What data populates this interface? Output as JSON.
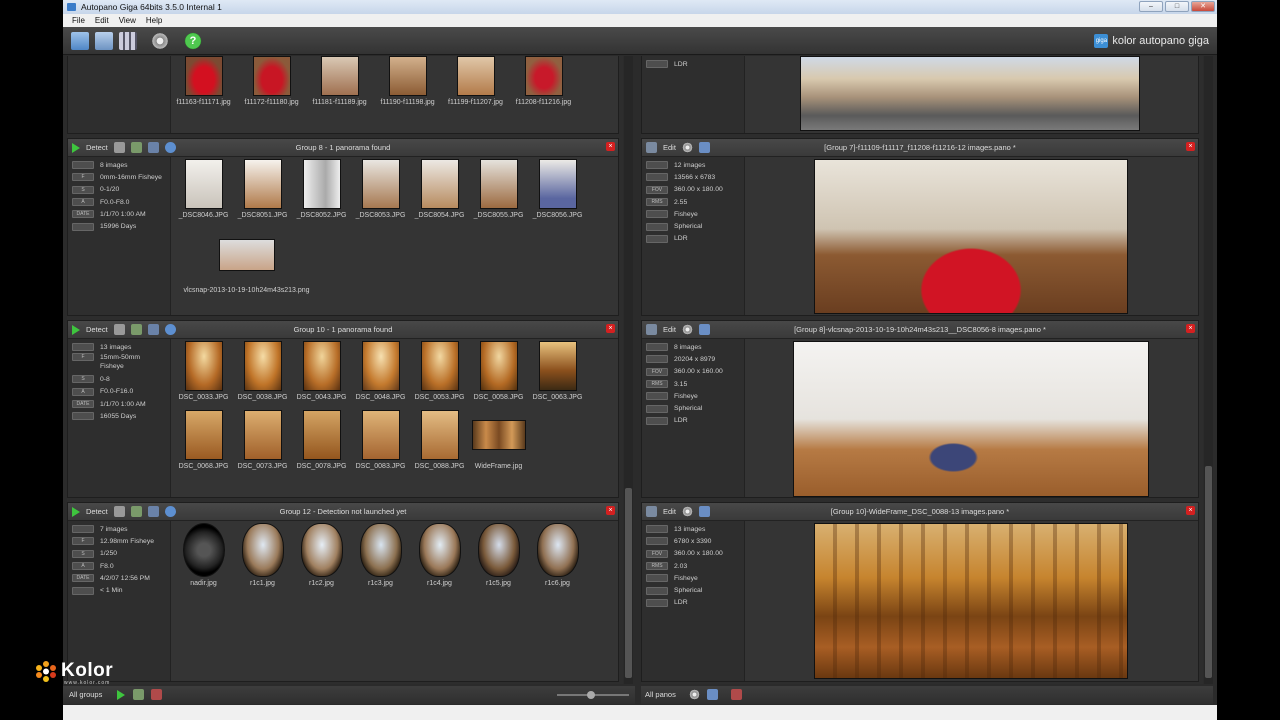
{
  "window": {
    "title": "Autopano Giga 64bits 3.5.0 Internal 1"
  },
  "menu": [
    "File",
    "Edit",
    "View",
    "Help"
  ],
  "brand": {
    "text": "kolor autopano giga",
    "logo": "giga"
  },
  "watermark": {
    "name": "Kolor",
    "site": "www.kolor.com"
  },
  "groups_panel": {
    "top_thumbs": [
      "f11163-f11171.jpg",
      "f11172-f11180.jpg",
      "f11181-f11189.jpg",
      "f11190-f11198.jpg",
      "f11199-f11207.jpg",
      "f11208-f11216.jpg"
    ],
    "detect_label": "Detect",
    "groups": [
      {
        "title": "Group 8 - 1 panorama found",
        "info": [
          "8 images",
          "0mm-16mm Fisheye",
          "0-1/20",
          "F0.0-F8.0",
          "1/1/70 1:00 AM",
          "15996 Days"
        ],
        "info_keys": [
          "",
          "F",
          "S",
          "A",
          "DATE",
          ""
        ],
        "thumbs": [
          "_DSC8046.JPG",
          "_DSC8051.JPG",
          "_DSC8052.JPG",
          "_DSC8053.JPG",
          "_DSC8054.JPG",
          "_DSC8055.JPG",
          "_DSC8056.JPG"
        ],
        "extra": "vlcsnap-2013-10-19-10h24m43s213.png"
      },
      {
        "title": "Group 10 - 1 panorama found",
        "info": [
          "13 images",
          "15mm-50mm Fisheye",
          "0-8",
          "F0.0-F16.0",
          "1/1/70 1:00 AM",
          "16055 Days"
        ],
        "info_keys": [
          "",
          "F",
          "S",
          "A",
          "DATE",
          ""
        ],
        "thumbs": [
          "DSC_0033.JPG",
          "DSC_0038.JPG",
          "DSC_0043.JPG",
          "DSC_0048.JPG",
          "DSC_0053.JPG",
          "DSC_0058.JPG",
          "DSC_0063.JPG",
          "DSC_0068.JPG",
          "DSC_0073.JPG",
          "DSC_0078.JPG",
          "DSC_0083.JPG",
          "DSC_0088.JPG",
          "WideFrame.jpg"
        ]
      },
      {
        "title": "Group 12 - Detection not launched yet",
        "info": [
          "7 images",
          "12.98mm Fisheye",
          "1/250",
          "F8.0",
          "4/2/07 12:56 PM",
          "< 1 Min"
        ],
        "info_keys": [
          "",
          "F",
          "S",
          "A",
          "DATE",
          ""
        ],
        "thumbs": [
          "nadir.jpg",
          "r1c1.jpg",
          "r1c2.jpg",
          "r1c3.jpg",
          "r1c4.jpg",
          "r1c5.jpg",
          "r1c6.jpg"
        ]
      }
    ],
    "footer": "All groups"
  },
  "panos_panel": {
    "top_info": "LDR",
    "edit_label": "Edit",
    "panos": [
      {
        "title": "[Group 7]-f11109-f11117_f11208-f11216-12 images.pano *",
        "info": [
          "12 images",
          "13566 x 6783",
          "360.00 x 180.00",
          "2.55",
          "Fisheye",
          "Spherical",
          "LDR"
        ],
        "info_keys": [
          "",
          "",
          "FOV",
          "RMS",
          "",
          "",
          ""
        ]
      },
      {
        "title": "[Group 8]-vlcsnap-2013-10-19-10h24m43s213__DSC8056-8 images.pano *",
        "info": [
          "8 images",
          "20204 x 8979",
          "360.00 x 160.00",
          "3.15",
          "Fisheye",
          "Spherical",
          "LDR"
        ],
        "info_keys": [
          "",
          "",
          "FOV",
          "RMS",
          "",
          "",
          ""
        ]
      },
      {
        "title": "[Group 10]-WideFrame_DSC_0088-13 images.pano *",
        "info": [
          "13 images",
          "6780 x 3390",
          "360.00 x 180.00",
          "2.03",
          "Fisheye",
          "Spherical",
          "LDR"
        ],
        "info_keys": [
          "",
          "",
          "FOV",
          "RMS",
          "",
          "",
          ""
        ]
      }
    ],
    "footer": "All panos"
  }
}
